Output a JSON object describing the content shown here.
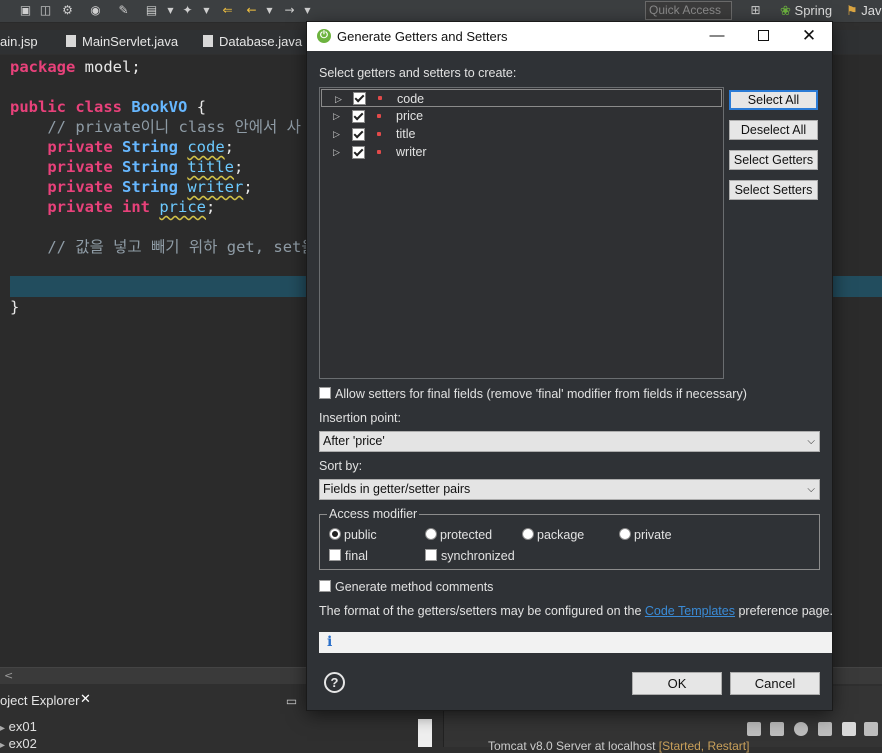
{
  "toolbar": {
    "quick_access_placeholder": "Quick Access",
    "perspective_spring": "Spring",
    "perspective_java": "Jav"
  },
  "editor_tabs": [
    {
      "label": "ain.jsp"
    },
    {
      "label": "MainServlet.java"
    },
    {
      "label": "Database.java"
    }
  ],
  "code": {
    "l1_kw": "package",
    "l1_rest": " model;",
    "l2_kw1": "public",
    "l2_kw2": "class",
    "l2_name": "BookVO",
    "l2_brace": " {",
    "l3_comment": "// private이니 class 안에서 사",
    "fields": [
      {
        "mod": "private",
        "type": "String",
        "name": "code"
      },
      {
        "mod": "private",
        "type": "String",
        "name": "title"
      },
      {
        "mod": "private",
        "type": "String",
        "name": "writer"
      },
      {
        "mod": "private",
        "type": "int",
        "name": "price"
      }
    ],
    "comment2": "// 값을 넣고 빼기 위하 get, set을",
    "close_brace": "}"
  },
  "bottom": {
    "project_explorer": "oject Explorer",
    "items": [
      "ex01",
      "ex02"
    ],
    "server_line": "Tomcat v8.0 Server at localhost",
    "server_status": "[Started, Restart]"
  },
  "dialog": {
    "title": "Generate Getters and Setters",
    "select_label": "Select getters and setters to create:",
    "fields": [
      {
        "name": "code",
        "checked": true
      },
      {
        "name": "price",
        "checked": true
      },
      {
        "name": "title",
        "checked": true
      },
      {
        "name": "writer",
        "checked": true
      }
    ],
    "buttons": {
      "select_all": "Select All",
      "deselect_all": "Deselect All",
      "select_getters": "Select Getters",
      "select_setters": "Select Setters",
      "ok": "OK",
      "cancel": "Cancel"
    },
    "allow_final": "Allow setters for final fields (remove 'final' modifier from fields if necessary)",
    "insertion_label": "Insertion point:",
    "insertion_value": "After 'price'",
    "sort_label": "Sort by:",
    "sort_value": "Fields in getter/setter pairs",
    "access_modifier": {
      "legend": "Access modifier",
      "public": "public",
      "protected": "protected",
      "package": "package",
      "private": "private",
      "final": "final",
      "synchronized": "synchronized",
      "selected": "public"
    },
    "generate_comments": "Generate method comments",
    "format_text_1": "The format of the getters/setters may be configured on the ",
    "format_link": "Code Templates",
    "format_text_2": " preference page.",
    "info_icon": "i"
  }
}
